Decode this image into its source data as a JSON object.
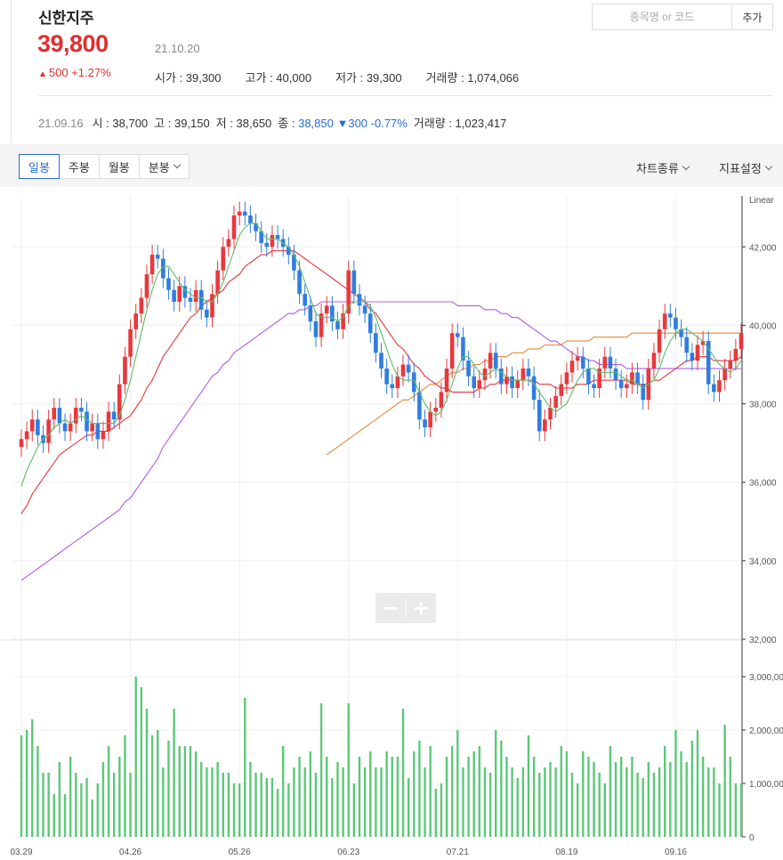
{
  "stock": {
    "name": "신한지주",
    "price": "39,800",
    "date": "21.10.20",
    "change_arrow": "▲",
    "change": "500 +1.27%",
    "open": "시가 : 39,300",
    "high": "고가 : 40,000",
    "low": "저가 : 39,300",
    "volume": "거래량 : 1,074,066"
  },
  "search": {
    "placeholder": "종목명 or 코드",
    "add_label": "추가"
  },
  "prev_day": {
    "date": "21.09.16",
    "open": "시 : 38,700",
    "high": "고 : 39,150",
    "low": "저 : 38,650",
    "close_label": "종 : ",
    "close_value": "38,850",
    "change": "▼300 -0.77%",
    "volume": "거래량 : 1,023,417"
  },
  "toolbar": {
    "tabs": [
      "일봉",
      "주봉",
      "월봉",
      "분봉"
    ],
    "active_tab": "일봉",
    "chart_type": "차트종류",
    "indicator_settings": "지표설정"
  },
  "colors": {
    "up": "#e8383d",
    "down": "#2f7de1",
    "ma5": "#5cbd6b",
    "ma20": "#e8383d",
    "ma60": "#b05ce8",
    "ma120": "#e8883a",
    "volume": "#5cc878",
    "accent": "#2c6bd6"
  },
  "zoom": {
    "minus_icon": "−",
    "plus_icon": "+"
  },
  "chart_data": {
    "type": "candlestick",
    "scale_label": "Linear",
    "price_axis": {
      "range": [
        32000,
        43300
      ],
      "ticks": [
        32000,
        34000,
        36000,
        38000,
        40000,
        42000
      ],
      "tick_labels": [
        "32,000",
        "34,000",
        "36,000",
        "38,000",
        "40,000",
        "42,000"
      ]
    },
    "volume_axis": {
      "range": [
        0,
        3500000
      ],
      "ticks": [
        0,
        1000000,
        2000000,
        3000000
      ],
      "tick_labels": [
        "0",
        "1,000,00",
        "2,000,00",
        "3,000,00"
      ]
    },
    "x_labels": [
      "03.29",
      "04.26",
      "05.26",
      "06.23",
      "07.21",
      "08.19",
      "09.16"
    ],
    "x_label_indices": [
      0,
      20,
      40,
      60,
      80,
      100,
      120
    ],
    "close": [
      37100,
      37300,
      37600,
      37200,
      37000,
      37600,
      37900,
      37500,
      37300,
      37500,
      37900,
      37800,
      37300,
      37500,
      37100,
      37300,
      37800,
      37600,
      38500,
      39200,
      39900,
      40300,
      40700,
      41300,
      41800,
      41700,
      41200,
      40900,
      40600,
      41000,
      40700,
      40600,
      40900,
      40400,
      40200,
      40800,
      41400,
      42000,
      42200,
      42800,
      42900,
      42800,
      42600,
      42400,
      42100,
      42000,
      42300,
      42200,
      42000,
      41800,
      41400,
      40800,
      40500,
      40100,
      39700,
      40300,
      40500,
      40100,
      39900,
      40300,
      41400,
      40800,
      40500,
      40300,
      39800,
      39300,
      38900,
      38500,
      38400,
      38700,
      39000,
      38800,
      38300,
      37600,
      37400,
      37800,
      37900,
      38300,
      38900,
      39800,
      39700,
      39100,
      38700,
      38400,
      38600,
      38900,
      39300,
      38900,
      38500,
      38700,
      38400,
      38600,
      38900,
      38700,
      38100,
      37300,
      37600,
      37900,
      38200,
      38500,
      38800,
      39100,
      39200,
      38900,
      38500,
      38400,
      38900,
      39200,
      38900,
      38600,
      38400,
      38500,
      38800,
      38500,
      38100,
      38900,
      39300,
      39900,
      40300,
      40200,
      39900,
      39700,
      39300,
      39100,
      39500,
      39600,
      38500,
      38300,
      38600,
      38900,
      39100,
      39400,
      39800
    ],
    "ma5": [
      35900,
      36300,
      36600,
      36900,
      37100,
      37200,
      37400,
      37500,
      37600,
      37500,
      37600,
      37700,
      37600,
      37500,
      37500,
      37500,
      37500,
      37500,
      37700,
      38100,
      38600,
      39200,
      39800,
      40400,
      40900,
      41300,
      41500,
      41500,
      41300,
      41100,
      40900,
      40800,
      40700,
      40700,
      40600,
      40600,
      40800,
      41100,
      41500,
      41900,
      42300,
      42500,
      42600,
      42600,
      42400,
      42200,
      42200,
      42200,
      42100,
      42000,
      41800,
      41500,
      41100,
      40700,
      40300,
      40200,
      40200,
      40200,
      40100,
      40200,
      40500,
      40600,
      40600,
      40600,
      40500,
      40200,
      39800,
      39400,
      39000,
      38700,
      38600,
      38600,
      38600,
      38300,
      38000,
      37800,
      37700,
      37800,
      38100,
      38500,
      38900,
      39200,
      39200,
      39000,
      38800,
      38700,
      38800,
      38900,
      38800,
      38700,
      38600,
      38600,
      38600,
      38600,
      38500,
      38300,
      38100,
      37900,
      37800,
      37900,
      38000,
      38300,
      38600,
      38800,
      38900,
      38900,
      38800,
      38800,
      38800,
      38800,
      38700,
      38600,
      38600,
      38500,
      38400,
      38500,
      38600,
      38900,
      39300,
      39600,
      39800,
      39900,
      39900,
      39800,
      39700,
      39600,
      39400,
      39200,
      39000,
      38900,
      38800,
      38900,
      39100
    ],
    "ma20": [
      35200,
      35400,
      35700,
      35900,
      36100,
      36300,
      36500,
      36700,
      36800,
      36900,
      37000,
      37100,
      37200,
      37200,
      37300,
      37300,
      37300,
      37400,
      37500,
      37600,
      37700,
      37900,
      38100,
      38400,
      38600,
      38900,
      39200,
      39400,
      39600,
      39800,
      40000,
      40200,
      40300,
      40500,
      40600,
      40700,
      40800,
      40900,
      41100,
      41200,
      41300,
      41500,
      41600,
      41700,
      41800,
      41800,
      41900,
      41900,
      41900,
      41900,
      41900,
      41800,
      41700,
      41600,
      41500,
      41400,
      41300,
      41200,
      41100,
      41000,
      40900,
      40800,
      40700,
      40600,
      40400,
      40300,
      40100,
      39900,
      39700,
      39500,
      39400,
      39200,
      39000,
      38900,
      38700,
      38600,
      38500,
      38400,
      38400,
      38300,
      38300,
      38300,
      38300,
      38300,
      38400,
      38400,
      38500,
      38500,
      38600,
      38600,
      38600,
      38600,
      38600,
      38600,
      38600,
      38500,
      38500,
      38500,
      38400,
      38400,
      38400,
      38400,
      38500,
      38500,
      38500,
      38600,
      38600,
      38600,
      38600,
      38600,
      38600,
      38600,
      38500,
      38500,
      38500,
      38500,
      38600,
      38600,
      38700,
      38800,
      38900,
      39000,
      39100,
      39100,
      39200,
      39200,
      39200,
      39100,
      39100,
      39100,
      39100,
      39100,
      39200
    ],
    "ma60": [
      33500,
      33600,
      33700,
      33800,
      33900,
      34000,
      34100,
      34200,
      34300,
      34400,
      34500,
      34600,
      34700,
      34800,
      34900,
      35000,
      35100,
      35200,
      35300,
      35500,
      35600,
      35800,
      36000,
      36200,
      36400,
      36600,
      36900,
      37100,
      37300,
      37500,
      37700,
      37900,
      38100,
      38300,
      38500,
      38700,
      38800,
      39000,
      39100,
      39300,
      39400,
      39500,
      39600,
      39700,
      39800,
      39900,
      40000,
      40100,
      40200,
      40300,
      40300,
      40400,
      40400,
      40500,
      40500,
      40600,
      40600,
      40600,
      40600,
      40600,
      40600,
      40600,
      40600,
      40600,
      40600,
      40600,
      40600,
      40600,
      40600,
      40600,
      40600,
      40600,
      40600,
      40600,
      40600,
      40600,
      40600,
      40600,
      40600,
      40600,
      40500,
      40500,
      40500,
      40500,
      40500,
      40400,
      40400,
      40400,
      40300,
      40300,
      40200,
      40200,
      40100,
      40000,
      39900,
      39800,
      39700,
      39600,
      39600,
      39500,
      39400,
      39300,
      39200,
      39200,
      39100,
      39100,
      39000,
      39000,
      39000,
      39000,
      39000,
      38900,
      38900,
      38900,
      38900,
      38900,
      38900,
      38900,
      38900,
      38900,
      38900,
      38900,
      38900,
      38900,
      38900,
      38900,
      38900,
      38900,
      38900,
      38900,
      38900,
      38900,
      38900
    ],
    "ma120": [
      null,
      null,
      null,
      null,
      null,
      null,
      null,
      null,
      null,
      null,
      null,
      null,
      null,
      null,
      null,
      null,
      null,
      null,
      null,
      null,
      null,
      null,
      null,
      null,
      null,
      null,
      null,
      null,
      null,
      null,
      null,
      null,
      null,
      null,
      null,
      null,
      null,
      null,
      null,
      null,
      null,
      null,
      null,
      null,
      null,
      null,
      null,
      null,
      null,
      null,
      null,
      null,
      null,
      null,
      null,
      null,
      36700,
      36800,
      36900,
      37000,
      37100,
      37200,
      37300,
      37400,
      37500,
      37600,
      37700,
      37800,
      37900,
      38000,
      38100,
      38100,
      38200,
      38300,
      38400,
      38500,
      38500,
      38600,
      38700,
      38800,
      38800,
      38900,
      38900,
      39000,
      39000,
      39100,
      39100,
      39200,
      39200,
      39200,
      39300,
      39300,
      39300,
      39400,
      39400,
      39400,
      39500,
      39500,
      39500,
      39500,
      39600,
      39600,
      39600,
      39600,
      39600,
      39700,
      39700,
      39700,
      39700,
      39700,
      39700,
      39700,
      39800,
      39800,
      39800,
      39800,
      39800,
      39800,
      39800,
      39800,
      39800,
      39800,
      39800,
      39800,
      39800,
      39800,
      39800,
      39800,
      39800,
      39800,
      39800,
      39800,
      39800
    ],
    "volume": [
      1900000,
      2000000,
      2200000,
      1700000,
      1200000,
      1200000,
      800000,
      1400000,
      800000,
      1500000,
      1200000,
      1000000,
      1100000,
      700000,
      1000000,
      1400000,
      1700000,
      1200000,
      1500000,
      1900000,
      1200000,
      3000000,
      2800000,
      2400000,
      1900000,
      2000000,
      1300000,
      1800000,
      2400000,
      1700000,
      1700000,
      1700000,
      1600000,
      1400000,
      1300000,
      1300000,
      1400000,
      1200000,
      1200000,
      1000000,
      1000000,
      2600000,
      1400000,
      1200000,
      1200000,
      1100000,
      1100000,
      900000,
      1700000,
      1000000,
      1300000,
      1500000,
      1300000,
      1600000,
      1200000,
      2500000,
      1500000,
      1100000,
      1400000,
      1300000,
      2500000,
      1000000,
      1500000,
      1300000,
      1600000,
      1300000,
      1300000,
      1600000,
      1500000,
      1500000,
      2400000,
      1100000,
      1600000,
      1800000,
      1300000,
      1700000,
      900000,
      1000000,
      1500000,
      1700000,
      2000000,
      1300000,
      1500000,
      1600000,
      1700000,
      1300000,
      1200000,
      2000000,
      1800000,
      1500000,
      1300000,
      1100000,
      1300000,
      1900000,
      1500000,
      1200000,
      1300000,
      1400000,
      1300000,
      1700000,
      1600000,
      1200000,
      1000000,
      1600000,
      1500000,
      1400000,
      1200000,
      1000000,
      1700000,
      1400000,
      1500000,
      1300000,
      1500000,
      1200000,
      1100000,
      1400000,
      1200000,
      1300000,
      1700000,
      1400000,
      2000000,
      1600000,
      1400000,
      1800000,
      2000000,
      1500000,
      1300000,
      1300000,
      1000000,
      2100000,
      1500000,
      1000000,
      1000000
    ]
  }
}
